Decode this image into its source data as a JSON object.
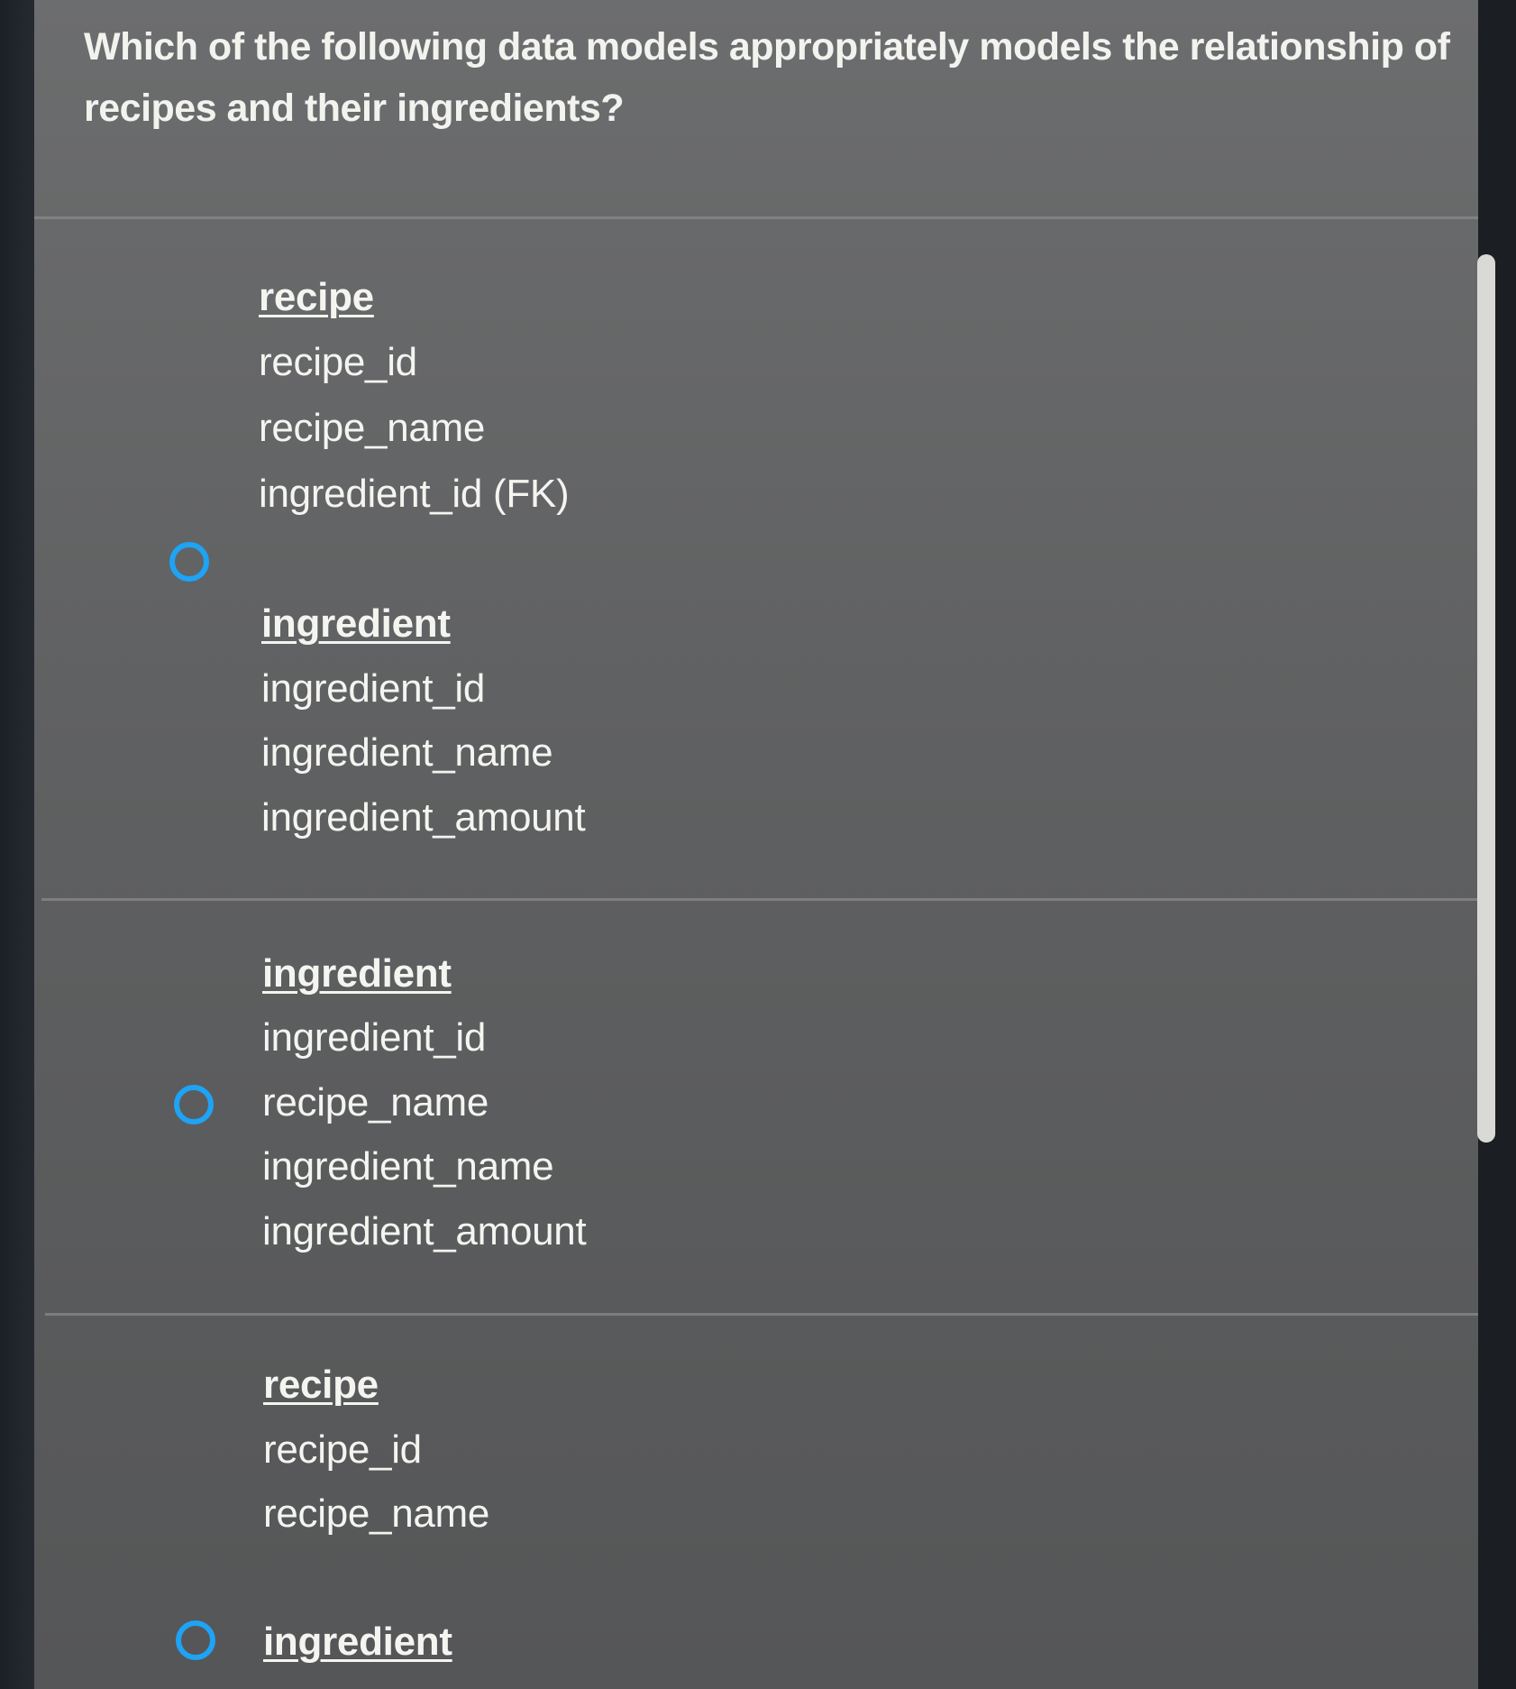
{
  "question": {
    "text": "Which of the following data models appropriately models the relationship of recipes and their ingredients?"
  },
  "options": [
    {
      "tables": [
        {
          "name": "recipe",
          "fields": [
            "recipe_id",
            "recipe_name",
            "ingredient_id (FK)"
          ]
        },
        {
          "name": "ingredient",
          "fields": [
            "ingredient_id",
            "ingredient_name",
            "ingredient_amount"
          ]
        }
      ],
      "selected": false
    },
    {
      "tables": [
        {
          "name": "ingredient",
          "fields": [
            "ingredient_id",
            "recipe_name",
            "ingredient_name",
            "ingredient_amount"
          ]
        }
      ],
      "selected": false
    },
    {
      "tables": [
        {
          "name": "recipe",
          "fields": [
            "recipe_id",
            "recipe_name"
          ]
        },
        {
          "name": "ingredient",
          "fields": []
        }
      ],
      "selected": false
    }
  ],
  "colors": {
    "radio_border": "#1ea3f5",
    "text": "#f4f4f0",
    "panel": "#5f6061"
  }
}
